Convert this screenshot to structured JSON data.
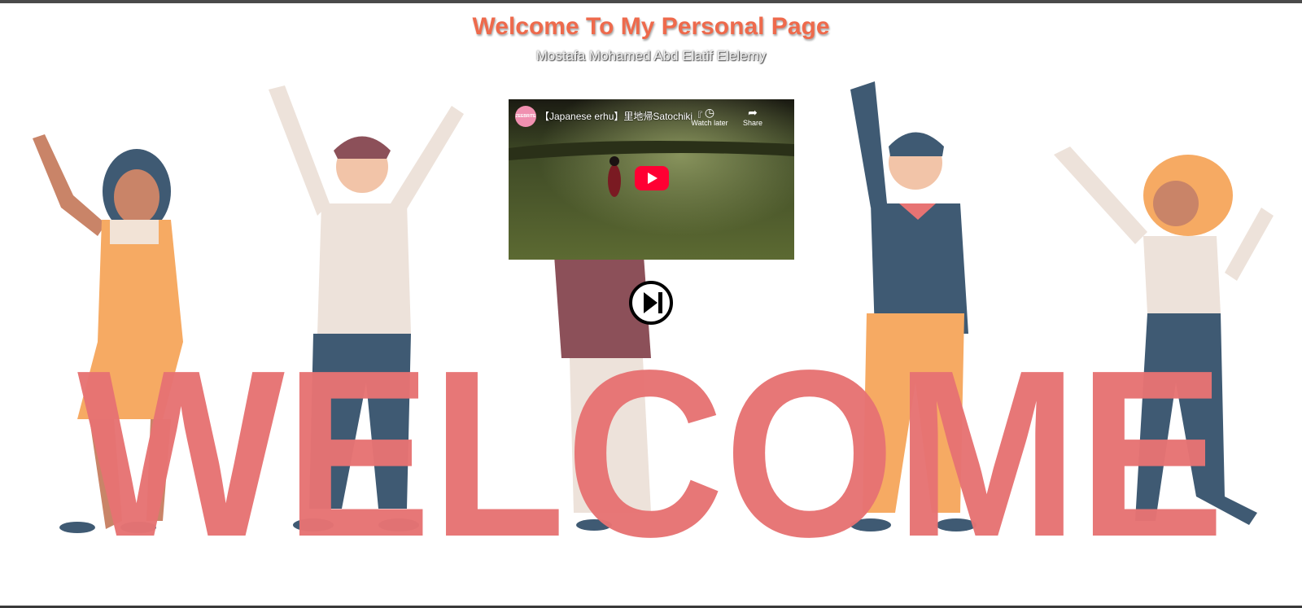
{
  "header": {
    "title": "Welcome To My Personal Page",
    "subtitle": "Mostafa Mohamed Abd Elatif Elelemy"
  },
  "background": {
    "word": "WELCOME",
    "letter_color": "#e77373",
    "accent_colors": [
      "#3f5a73",
      "#f6aa63",
      "#ede2da",
      "#8c5059"
    ]
  },
  "video": {
    "title": "【Japanese erhu】里地帰Satochiki『...",
    "channel_badge": "ZEEBRITE",
    "watch_later_label": "Watch later",
    "share_label": "Share",
    "play_color": "#ff0033"
  },
  "controls": {
    "next_icon": "skip-next-icon"
  }
}
